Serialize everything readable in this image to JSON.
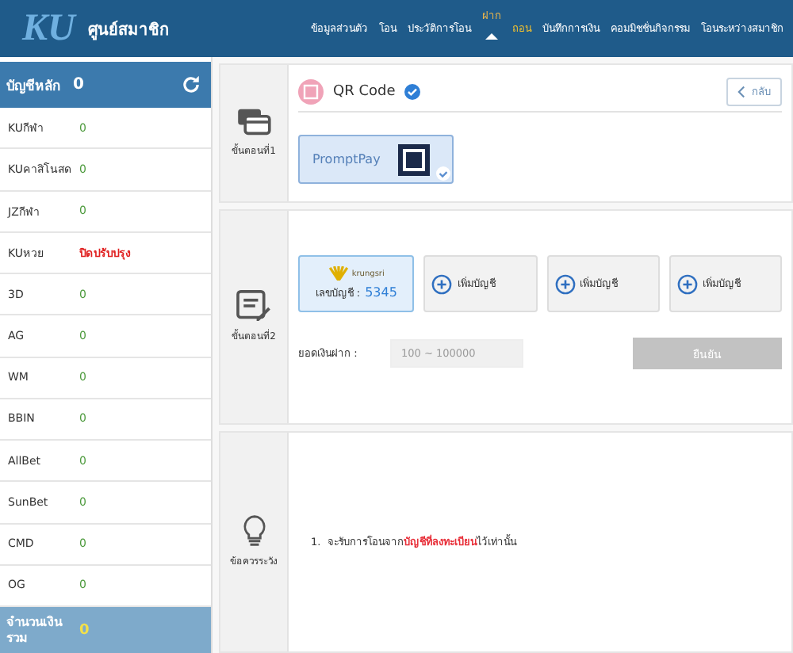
{
  "header": {
    "logo": "KU",
    "title": "ศูนย์สมาชิก",
    "nav": [
      {
        "label": "ข้อมูลส่วนตัว",
        "selected": false,
        "highlight": false
      },
      {
        "label": "โอน",
        "selected": false,
        "highlight": false
      },
      {
        "label": "ประวัติการโอน",
        "selected": false,
        "highlight": false
      },
      {
        "label": "ฝาก",
        "selected": true,
        "highlight": false
      },
      {
        "label": "ถอน",
        "selected": false,
        "highlight": true
      },
      {
        "label": "บันทึกการเงิน",
        "selected": false,
        "highlight": false
      },
      {
        "label": "คอมมิชชั่นกิจกรรม",
        "selected": false,
        "highlight": false
      },
      {
        "label": "โอนระหว่างสมาชิก",
        "selected": false,
        "highlight": false
      }
    ]
  },
  "sidebar": {
    "main": {
      "label": "บัญชีหลัก",
      "value": "0"
    },
    "wallets": [
      {
        "name": "KUกีฬา",
        "value": "0",
        "kind": "ok"
      },
      {
        "name": "KUคาสิโนสด",
        "value": "0",
        "kind": "ok"
      },
      {
        "name": "JZกีฬา",
        "value": "0",
        "kind": "ok"
      },
      {
        "name": "KUหวย",
        "value": "ปิดปรับปรุง",
        "kind": "maintenance"
      },
      {
        "name": "3D",
        "value": "0",
        "kind": "ok"
      },
      {
        "name": "AG",
        "value": "0",
        "kind": "ok"
      },
      {
        "name": "WM",
        "value": "0",
        "kind": "ok"
      },
      {
        "name": "BBIN",
        "value": "0",
        "kind": "ok"
      },
      {
        "name": "AllBet",
        "value": "0",
        "kind": "ok"
      },
      {
        "name": "SunBet",
        "value": "0",
        "kind": "ok"
      },
      {
        "name": "CMD",
        "value": "0",
        "kind": "ok"
      },
      {
        "name": "OG",
        "value": "0",
        "kind": "ok"
      }
    ],
    "total": {
      "label": "จำนวนเงินรวม",
      "value": "0"
    }
  },
  "step1": {
    "label": "ขั้นตอนที่1",
    "method": "QR Code",
    "back": "กลับ",
    "options": [
      {
        "label": "PromptPay",
        "selected": true
      }
    ]
  },
  "step2": {
    "label": "ขั้นตอนที่2",
    "accounts": [
      {
        "kind": "bank",
        "bank": "krungsri",
        "account_label": "เลขบัญชี :",
        "account_no": "5345",
        "selected": true
      },
      {
        "kind": "add",
        "label": "เพิ่มบัญชี",
        "selected": false
      },
      {
        "kind": "add",
        "label": "เพิ่มบัญชี",
        "selected": false
      },
      {
        "kind": "add",
        "label": "เพิ่มบัญชี",
        "selected": false
      }
    ],
    "amount_label": "ยอดเงินฝาก :",
    "amount_placeholder": "100 ~ 100000",
    "confirm": {
      "label": "ยืนยัน",
      "disabled": true
    }
  },
  "step3": {
    "label": "ข้อควรระวัง",
    "notes": [
      "1.  จะรับการโอนจาก**บัญชีที่ลงทะเบียน**ไว้เท่านั้น"
    ]
  }
}
